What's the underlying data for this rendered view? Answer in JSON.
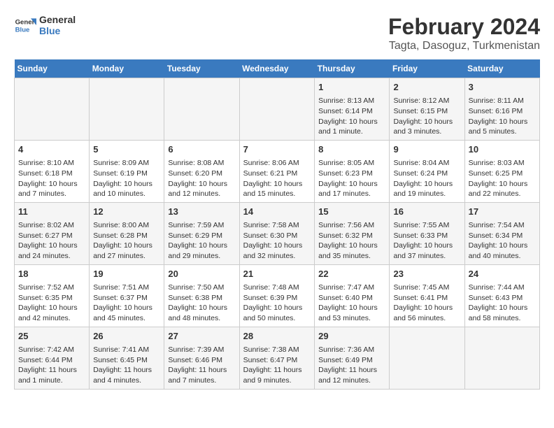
{
  "logo": {
    "line1": "General",
    "line2": "Blue"
  },
  "title": "February 2024",
  "subtitle": "Tagta, Dasoguz, Turkmenistan",
  "days_of_week": [
    "Sunday",
    "Monday",
    "Tuesday",
    "Wednesday",
    "Thursday",
    "Friday",
    "Saturday"
  ],
  "weeks": [
    [
      {
        "day": "",
        "content": ""
      },
      {
        "day": "",
        "content": ""
      },
      {
        "day": "",
        "content": ""
      },
      {
        "day": "",
        "content": ""
      },
      {
        "day": "1",
        "content": "Sunrise: 8:13 AM\nSunset: 6:14 PM\nDaylight: 10 hours and 1 minute."
      },
      {
        "day": "2",
        "content": "Sunrise: 8:12 AM\nSunset: 6:15 PM\nDaylight: 10 hours and 3 minutes."
      },
      {
        "day": "3",
        "content": "Sunrise: 8:11 AM\nSunset: 6:16 PM\nDaylight: 10 hours and 5 minutes."
      }
    ],
    [
      {
        "day": "4",
        "content": "Sunrise: 8:10 AM\nSunset: 6:18 PM\nDaylight: 10 hours and 7 minutes."
      },
      {
        "day": "5",
        "content": "Sunrise: 8:09 AM\nSunset: 6:19 PM\nDaylight: 10 hours and 10 minutes."
      },
      {
        "day": "6",
        "content": "Sunrise: 8:08 AM\nSunset: 6:20 PM\nDaylight: 10 hours and 12 minutes."
      },
      {
        "day": "7",
        "content": "Sunrise: 8:06 AM\nSunset: 6:21 PM\nDaylight: 10 hours and 15 minutes."
      },
      {
        "day": "8",
        "content": "Sunrise: 8:05 AM\nSunset: 6:23 PM\nDaylight: 10 hours and 17 minutes."
      },
      {
        "day": "9",
        "content": "Sunrise: 8:04 AM\nSunset: 6:24 PM\nDaylight: 10 hours and 19 minutes."
      },
      {
        "day": "10",
        "content": "Sunrise: 8:03 AM\nSunset: 6:25 PM\nDaylight: 10 hours and 22 minutes."
      }
    ],
    [
      {
        "day": "11",
        "content": "Sunrise: 8:02 AM\nSunset: 6:27 PM\nDaylight: 10 hours and 24 minutes."
      },
      {
        "day": "12",
        "content": "Sunrise: 8:00 AM\nSunset: 6:28 PM\nDaylight: 10 hours and 27 minutes."
      },
      {
        "day": "13",
        "content": "Sunrise: 7:59 AM\nSunset: 6:29 PM\nDaylight: 10 hours and 29 minutes."
      },
      {
        "day": "14",
        "content": "Sunrise: 7:58 AM\nSunset: 6:30 PM\nDaylight: 10 hours and 32 minutes."
      },
      {
        "day": "15",
        "content": "Sunrise: 7:56 AM\nSunset: 6:32 PM\nDaylight: 10 hours and 35 minutes."
      },
      {
        "day": "16",
        "content": "Sunrise: 7:55 AM\nSunset: 6:33 PM\nDaylight: 10 hours and 37 minutes."
      },
      {
        "day": "17",
        "content": "Sunrise: 7:54 AM\nSunset: 6:34 PM\nDaylight: 10 hours and 40 minutes."
      }
    ],
    [
      {
        "day": "18",
        "content": "Sunrise: 7:52 AM\nSunset: 6:35 PM\nDaylight: 10 hours and 42 minutes."
      },
      {
        "day": "19",
        "content": "Sunrise: 7:51 AM\nSunset: 6:37 PM\nDaylight: 10 hours and 45 minutes."
      },
      {
        "day": "20",
        "content": "Sunrise: 7:50 AM\nSunset: 6:38 PM\nDaylight: 10 hours and 48 minutes."
      },
      {
        "day": "21",
        "content": "Sunrise: 7:48 AM\nSunset: 6:39 PM\nDaylight: 10 hours and 50 minutes."
      },
      {
        "day": "22",
        "content": "Sunrise: 7:47 AM\nSunset: 6:40 PM\nDaylight: 10 hours and 53 minutes."
      },
      {
        "day": "23",
        "content": "Sunrise: 7:45 AM\nSunset: 6:41 PM\nDaylight: 10 hours and 56 minutes."
      },
      {
        "day": "24",
        "content": "Sunrise: 7:44 AM\nSunset: 6:43 PM\nDaylight: 10 hours and 58 minutes."
      }
    ],
    [
      {
        "day": "25",
        "content": "Sunrise: 7:42 AM\nSunset: 6:44 PM\nDaylight: 11 hours and 1 minute."
      },
      {
        "day": "26",
        "content": "Sunrise: 7:41 AM\nSunset: 6:45 PM\nDaylight: 11 hours and 4 minutes."
      },
      {
        "day": "27",
        "content": "Sunrise: 7:39 AM\nSunset: 6:46 PM\nDaylight: 11 hours and 7 minutes."
      },
      {
        "day": "28",
        "content": "Sunrise: 7:38 AM\nSunset: 6:47 PM\nDaylight: 11 hours and 9 minutes."
      },
      {
        "day": "29",
        "content": "Sunrise: 7:36 AM\nSunset: 6:49 PM\nDaylight: 11 hours and 12 minutes."
      },
      {
        "day": "",
        "content": ""
      },
      {
        "day": "",
        "content": ""
      }
    ]
  ]
}
